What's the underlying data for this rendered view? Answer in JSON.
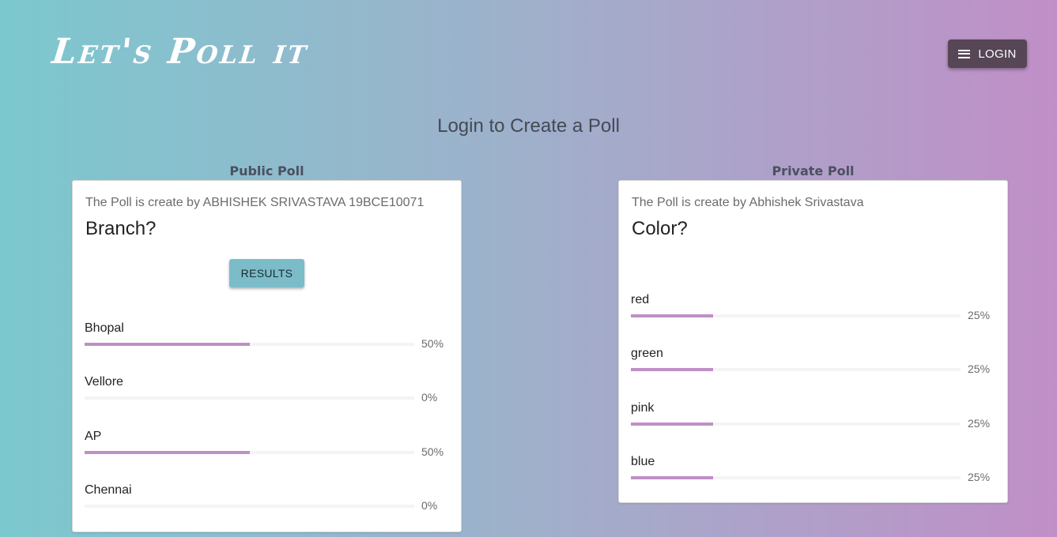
{
  "header": {
    "brand": "Let's Poll it",
    "login_label": "LOGIN"
  },
  "subtitle": "Login to Create a Poll",
  "public_poll": {
    "section_title": "Public Poll",
    "creator": "The Poll is create by ABHISHEK SRIVASTAVA 19BCE10071",
    "question": "Branch?",
    "results_label": "RESULTS",
    "options": [
      {
        "label": "Bhopal",
        "percent_text": "50%",
        "fraction": 0.5
      },
      {
        "label": "Vellore",
        "percent_text": "0%",
        "fraction": 0
      },
      {
        "label": "AP",
        "percent_text": "50%",
        "fraction": 0.5
      },
      {
        "label": "Chennai",
        "percent_text": "0%",
        "fraction": 0
      }
    ]
  },
  "private_poll": {
    "section_title": "Private Poll",
    "creator": "The Poll is create by Abhishek Srivastava",
    "question": "Color?",
    "options": [
      {
        "label": "red",
        "percent_text": "25%",
        "fraction": 0.25
      },
      {
        "label": "green",
        "percent_text": "25%",
        "fraction": 0.25
      },
      {
        "label": "pink",
        "percent_text": "25%",
        "fraction": 0.25
      },
      {
        "label": "blue",
        "percent_text": "25%",
        "fraction": 0.25
      }
    ]
  },
  "colors": {
    "gradient_start": "#7cc8cf",
    "gradient_end": "#c08fc7",
    "bar_fill": "#c08fc7",
    "login_button": "#564656",
    "results_button": "#7bbcc8"
  },
  "icons": {
    "login": "menu-icon"
  }
}
